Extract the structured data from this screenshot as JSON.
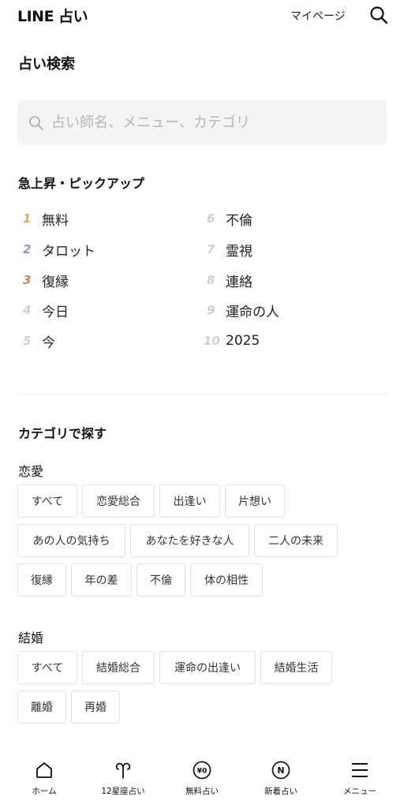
{
  "header": {
    "logo": "LINE 占い",
    "mypage_label": "マイページ"
  },
  "page_title": "占い検索",
  "search": {
    "placeholder": "占い師名、メニュー、カテゴリ"
  },
  "trending": {
    "title": "急上昇・ピックアップ",
    "items": [
      {
        "rank": "1",
        "label": "無料",
        "color": "#d4b157"
      },
      {
        "rank": "2",
        "label": "タロット",
        "color": "#8d97b8"
      },
      {
        "rank": "3",
        "label": "復縁",
        "color": "#c98658"
      },
      {
        "rank": "4",
        "label": "今日"
      },
      {
        "rank": "5",
        "label": "今"
      },
      {
        "rank": "6",
        "label": "不倫"
      },
      {
        "rank": "7",
        "label": "霊視"
      },
      {
        "rank": "8",
        "label": "連絡"
      },
      {
        "rank": "9",
        "label": "運命の人"
      },
      {
        "rank": "10",
        "label": "2025"
      }
    ]
  },
  "category": {
    "title": "カテゴリで探す",
    "love": {
      "title": "恋愛",
      "chips": [
        "すべて",
        "恋愛総合",
        "出逢い",
        "片想い",
        "あの人の気持ち",
        "あなたを好きな人",
        "二人の未来",
        "復縁",
        "年の差",
        "不倫",
        "体の相性"
      ]
    },
    "marriage": {
      "title": "結婚",
      "chips": [
        "すべて",
        "結婚総合",
        "運命の出逢い",
        "結婚生活",
        "離婚",
        "再婚"
      ]
    }
  },
  "bottom_nav": [
    {
      "label": "ホーム",
      "icon": "home-icon"
    },
    {
      "label": "12星座占い",
      "icon": "aries-icon"
    },
    {
      "label": "無料占い",
      "icon": "free-yen-icon",
      "badge": "¥0"
    },
    {
      "label": "新着占い",
      "icon": "new-icon",
      "badge": "N"
    },
    {
      "label": "メニュー",
      "icon": "menu-icon"
    }
  ]
}
